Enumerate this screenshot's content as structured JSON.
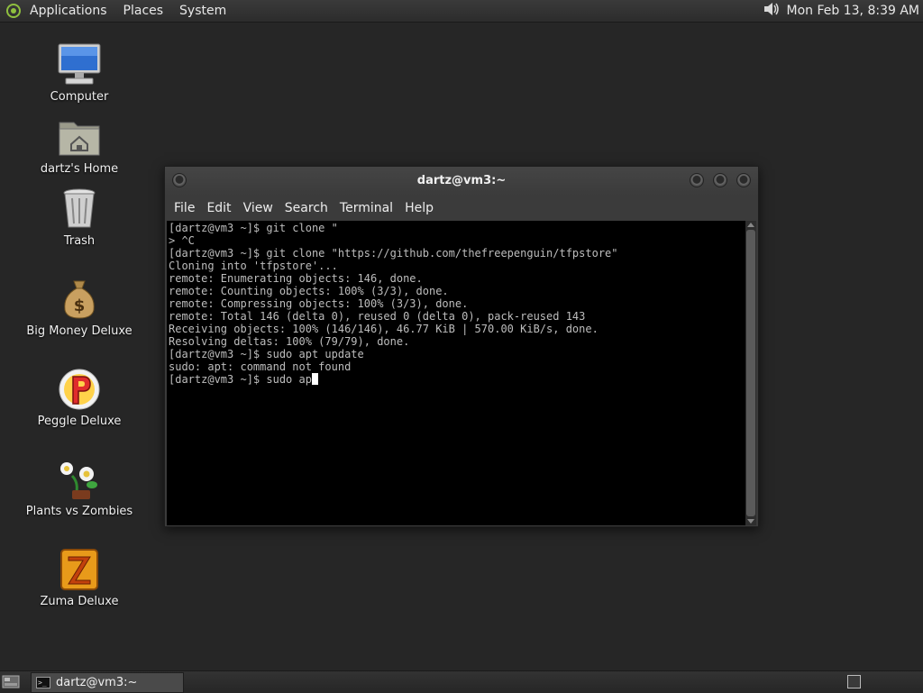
{
  "top_panel": {
    "menus": [
      "Applications",
      "Places",
      "System"
    ],
    "clock": "Mon Feb 13,  8:39 AM",
    "volume_icon": "speaker-icon"
  },
  "desktop": {
    "icons": [
      {
        "label": "Computer",
        "icon": "computer-icon"
      },
      {
        "label": "dartz's Home",
        "icon": "home-folder-icon"
      },
      {
        "label": "Trash",
        "icon": "trash-icon"
      },
      {
        "label": "Big Money Deluxe",
        "icon": "money-bag-icon"
      },
      {
        "label": "Peggle Deluxe",
        "icon": "peggle-icon"
      },
      {
        "label": "Plants vs Zombies",
        "icon": "plants-vs-zombies-icon"
      },
      {
        "label": "Zuma Deluxe",
        "icon": "zuma-icon"
      }
    ]
  },
  "terminal": {
    "title": "dartz@vm3:~",
    "menu": [
      "File",
      "Edit",
      "View",
      "Search",
      "Terminal",
      "Help"
    ],
    "lines": [
      "[dartz@vm3 ~]$ git clone \"",
      "> ^C",
      "[dartz@vm3 ~]$ git clone \"https://github.com/thefreepenguin/tfpstore\"",
      "Cloning into 'tfpstore'...",
      "remote: Enumerating objects: 146, done.",
      "remote: Counting objects: 100% (3/3), done.",
      "remote: Compressing objects: 100% (3/3), done.",
      "remote: Total 146 (delta 0), reused 0 (delta 0), pack-reused 143",
      "Receiving objects: 100% (146/146), 46.77 KiB | 570.00 KiB/s, done.",
      "Resolving deltas: 100% (79/79), done.",
      "[dartz@vm3 ~]$ sudo apt update",
      "sudo: apt: command not found"
    ],
    "current_input": "[dartz@vm3 ~]$ sudo ap"
  },
  "taskbar": {
    "task_label": "dartz@vm3:~"
  },
  "colors": {
    "desktop_bg": "#262626",
    "terminal_bg": "#000000",
    "terminal_fg": "#bdbdbd"
  }
}
